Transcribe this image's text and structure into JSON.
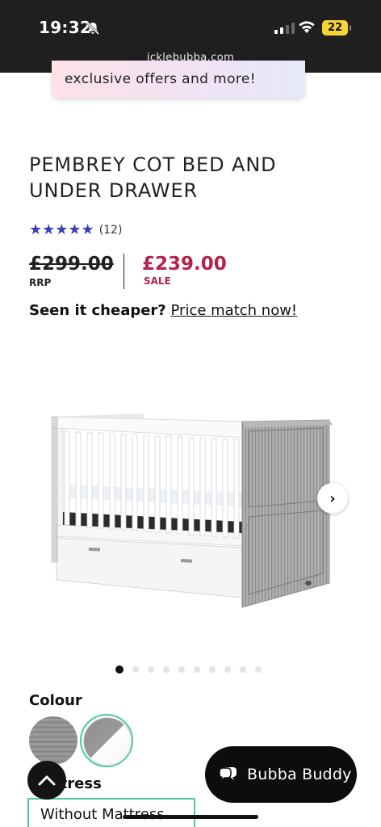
{
  "status_bar": {
    "time": "19:32",
    "battery": "22",
    "url": "icklebubba.com"
  },
  "promo": {
    "text": "exclusive offers and more!"
  },
  "product": {
    "title": "PEMBREY COT BED AND UNDER DRAWER",
    "rating_stars": "★★★★★",
    "rating_value": 5,
    "review_count": "(12)",
    "rrp_price": "£299.00",
    "rrp_label": "RRP",
    "sale_price": "£239.00",
    "sale_label": "SALE",
    "price_match_question": "Seen it cheaper?",
    "price_match_link": "Price match now!"
  },
  "gallery": {
    "next_arrow": "›",
    "total_images": 10,
    "active_index": 0
  },
  "options": {
    "colour_label": "Colour",
    "mattress_label": "Mattress",
    "mattress_value": "Without Mattress"
  },
  "chat": {
    "label": "Bubba Buddy"
  },
  "colors": {
    "accent": "#4fc7a5",
    "sale": "#b5224a",
    "stars": "#3a3fb7"
  }
}
